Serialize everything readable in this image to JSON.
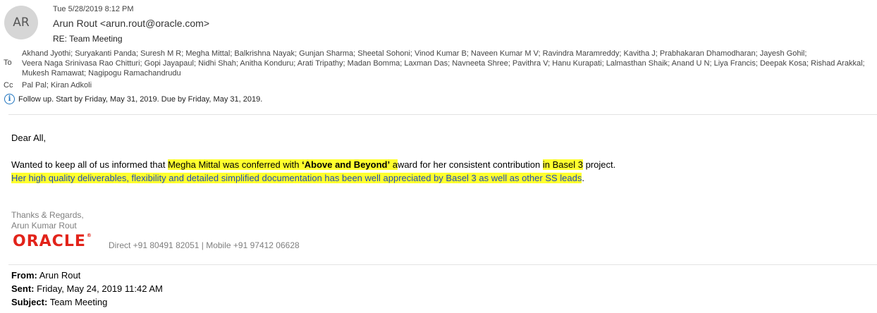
{
  "header": {
    "avatar_initials": "AR",
    "date": "Tue 5/28/2019 8:12 PM",
    "sender": "Arun Rout <arun.rout@oracle.com>",
    "subject": "RE: Team Meeting",
    "to_label": "To",
    "to_line1": "Akhand Jyothi; Suryakanti Panda; Suresh M R; Megha Mittal; Balkrishna Nayak; Gunjan Sharma; Sheetal Sohoni; Vinod Kumar B; Naveen Kumar M V; Ravindra Maramreddy; Kavitha J; Prabhakaran Dhamodharan; Jayesh Gohil;",
    "to_line2": "Veera Naga Srinivasa Rao Chitturi; Gopi Jayapaul; Nidhi Shah; Anitha Konduru; Arati Tripathy; Madan Bomma; Laxman Das; Navneeta Shree; Pavithra V; Hanu Kurapati; Lalmasthan Shaik; Anand U N; Liya Francis; Deepak Kosa; Rishad Arakkal;",
    "to_line3": "Mukesh Ramawat; Nagipogu Ramachandrudu",
    "cc_label": "Cc",
    "cc_value": "Pal Pal; Kiran Adkoli",
    "follow_up": "Follow up.  Start by Friday, May 31, 2019.  Due by Friday, May 31, 2019."
  },
  "message": {
    "greeting": "Dear All,",
    "p2_a": "Wanted to keep all of us informed that ",
    "p2_b": "Megha Mittal was conferred with ",
    "p2_c": "‘Above and Beyond’",
    "p2_d": " a",
    "p2_e": "ward for her consistent contribution ",
    "p2_f": "in Basel 3",
    "p2_g": " project.",
    "p3_a": "Her high quality deliverables, flexibility and detailed simplified documentation has been well appreciated by Basel 3 as well as other SS lea",
    "p3_b": "ds",
    "p3_c": "."
  },
  "signature": {
    "line1": "Thanks & Regards,",
    "line2": "Arun Kumar Rout",
    "logo_text": "ORACLE",
    "logo_mark": "®",
    "contact": "Direct +91 80491 82051 | Mobile +91 97412 06628"
  },
  "quoted": {
    "from_label": "From:",
    "from_value": "Arun Rout",
    "sent_label": "Sent:",
    "sent_value": "Friday, May 24, 2019 11:42 AM",
    "subject_label": "Subject:",
    "subject_value": "Team Meeting"
  }
}
